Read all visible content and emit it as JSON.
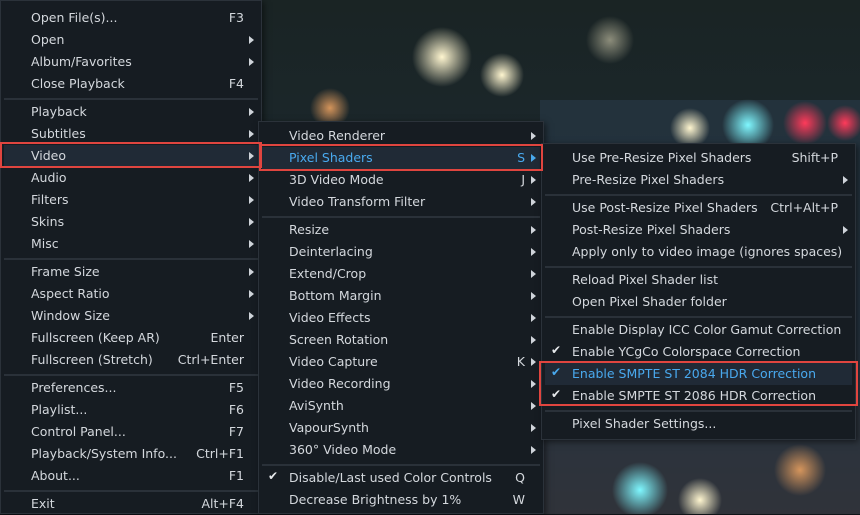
{
  "menu1": [
    {
      "label": "Open File(s)...",
      "shortcut": "F3"
    },
    {
      "label": "Open",
      "submenu": true
    },
    {
      "label": "Album/Favorites",
      "submenu": true
    },
    {
      "label": "Close Playback",
      "shortcut": "F4"
    },
    {
      "separator": true
    },
    {
      "label": "Playback",
      "submenu": true
    },
    {
      "label": "Subtitles",
      "submenu": true
    },
    {
      "label": "Video",
      "submenu": true,
      "selected": true
    },
    {
      "label": "Audio",
      "submenu": true
    },
    {
      "label": "Filters",
      "submenu": true
    },
    {
      "label": "Skins",
      "submenu": true
    },
    {
      "label": "Misc",
      "submenu": true
    },
    {
      "separator": true
    },
    {
      "label": "Frame Size",
      "submenu": true
    },
    {
      "label": "Aspect Ratio",
      "submenu": true
    },
    {
      "label": "Window Size",
      "submenu": true
    },
    {
      "label": "Fullscreen (Keep AR)",
      "shortcut": "Enter"
    },
    {
      "label": "Fullscreen (Stretch)",
      "shortcut": "Ctrl+Enter"
    },
    {
      "separator": true
    },
    {
      "label": "Preferences...",
      "shortcut": "F5"
    },
    {
      "label": "Playlist...",
      "shortcut": "F6"
    },
    {
      "label": "Control Panel...",
      "shortcut": "F7"
    },
    {
      "label": "Playback/System Info...",
      "shortcut": "Ctrl+F1"
    },
    {
      "label": "About...",
      "shortcut": "F1"
    },
    {
      "separator": true
    },
    {
      "label": "Exit",
      "shortcut": "Alt+F4"
    }
  ],
  "menu2": [
    {
      "label": "Video Renderer",
      "submenu": true
    },
    {
      "label": "Pixel Shaders",
      "shortcut": "S",
      "submenu": true,
      "selected": true,
      "highlight": true
    },
    {
      "label": "3D Video Mode",
      "shortcut": "J",
      "submenu": true
    },
    {
      "label": "Video Transform Filter",
      "submenu": true
    },
    {
      "separator": true
    },
    {
      "label": "Resize",
      "submenu": true
    },
    {
      "label": "Deinterlacing",
      "submenu": true
    },
    {
      "label": "Extend/Crop",
      "submenu": true
    },
    {
      "label": "Bottom Margin",
      "submenu": true
    },
    {
      "label": "Video Effects",
      "submenu": true
    },
    {
      "label": "Screen Rotation",
      "submenu": true
    },
    {
      "label": "Video Capture",
      "shortcut": "K",
      "submenu": true
    },
    {
      "label": "Video Recording",
      "submenu": true
    },
    {
      "label": "AviSynth",
      "submenu": true
    },
    {
      "label": "VapourSynth",
      "submenu": true
    },
    {
      "label": "360° Video Mode",
      "submenu": true
    },
    {
      "separator": true
    },
    {
      "label": "Disable/Last used Color Controls",
      "shortcut": "Q",
      "checked": true
    },
    {
      "label": "Decrease Brightness by 1%",
      "shortcut": "W"
    }
  ],
  "menu3": [
    {
      "label": "Use Pre-Resize Pixel Shaders",
      "shortcut": "Shift+P"
    },
    {
      "label": "Pre-Resize Pixel Shaders",
      "submenu": true
    },
    {
      "separator": true
    },
    {
      "label": "Use Post-Resize Pixel Shaders",
      "shortcut": "Ctrl+Alt+P"
    },
    {
      "label": "Post-Resize Pixel Shaders",
      "submenu": true
    },
    {
      "label": "Apply only to video image (ignores spaces)"
    },
    {
      "separator": true
    },
    {
      "label": "Reload Pixel Shader list"
    },
    {
      "label": "Open Pixel Shader folder"
    },
    {
      "separator": true
    },
    {
      "label": "Enable Display ICC Color Gamut Correction"
    },
    {
      "label": "Enable YCgCo Colorspace Correction",
      "checked": true
    },
    {
      "label": "Enable SMPTE ST 2084 HDR Correction",
      "checked": true,
      "highlight": true,
      "selected": true
    },
    {
      "label": "Enable SMPTE ST 2086 HDR Correction",
      "checked": true
    },
    {
      "separator": true
    },
    {
      "label": "Pixel Shader Settings..."
    }
  ],
  "colors": {
    "accent": "#49a9ee",
    "highlight_box": "#e0453f",
    "menu_bg": "#161c22"
  },
  "icons": {
    "check": "✔",
    "submenu_arrow": "chevron-right-icon"
  }
}
